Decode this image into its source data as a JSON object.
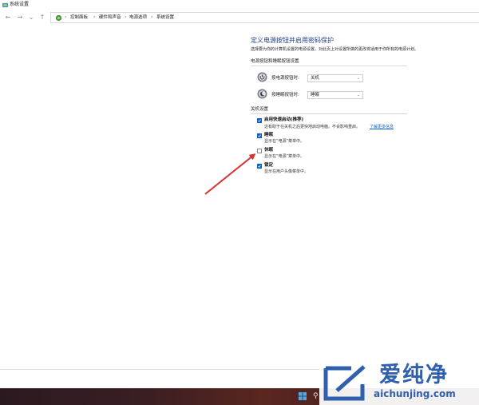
{
  "window": {
    "title": "系统设置"
  },
  "nav": {
    "back": "←",
    "forward": "→",
    "recent": "⌄",
    "up": "↑"
  },
  "breadcrumb": [
    "控制面板",
    "硬件和声音",
    "电源选项",
    "系统设置"
  ],
  "breadcrumb_sep": "›",
  "page": {
    "title": "定义电源按钮并启用密码保护",
    "description": "选择要为你的计算机设置的电源设置。对此页上对设置所做的更改将适用于你所有的电源计划。"
  },
  "power_section": {
    "heading": "电源按钮和睡眠按钮设置",
    "rows": [
      {
        "label": "按电源按钮时:",
        "value": "关机",
        "icon": "power-icon"
      },
      {
        "label": "按睡眠按钮时:",
        "value": "睡眠",
        "icon": "sleep-icon"
      }
    ]
  },
  "shutdown_section": {
    "heading": "关机设置",
    "items": [
      {
        "label": "启用快速启动(推荐)",
        "desc": "这有助于在关机之后更快地启动电脑。不会影响重启。",
        "link": "了解更多信息",
        "checked": true
      },
      {
        "label": "睡眠",
        "desc": "显示在“电源”菜单中。",
        "checked": true
      },
      {
        "label": "休眠",
        "desc": "显示在“电源”菜单中。",
        "checked": false
      },
      {
        "label": "锁定",
        "desc": "显示在用户头像菜单中。",
        "checked": true
      }
    ]
  },
  "watermark": {
    "brand": "爱纯净",
    "url": "aichunjing.com"
  },
  "colors": {
    "accent": "#0b61c4",
    "title": "#1e3d8c",
    "arrow": "#d9302c",
    "watermark": "#2f5fad"
  }
}
